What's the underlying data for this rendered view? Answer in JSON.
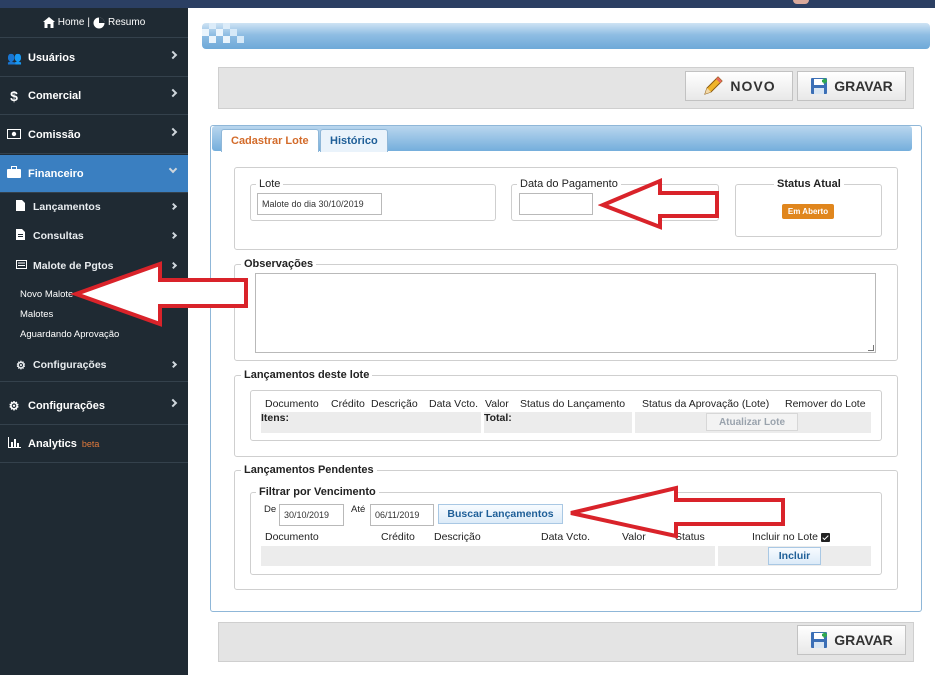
{
  "sidebar": {
    "home_label": "Home",
    "resumo_label": "Resumo",
    "items": [
      {
        "label": "Usuários",
        "icon": "users-icon"
      },
      {
        "label": "Comercial",
        "icon": "dollar-icon"
      },
      {
        "label": "Comissão",
        "icon": "money-icon"
      },
      {
        "label": "Financeiro",
        "icon": "briefcase-icon"
      },
      {
        "label": "Configurações",
        "icon": "gears-icon"
      },
      {
        "label": "Analytics",
        "icon": "bar-chart-icon"
      }
    ],
    "beta_label": "beta",
    "sub_items": [
      {
        "label": "Lançamentos",
        "icon": "file-icon"
      },
      {
        "label": "Consultas",
        "icon": "file-text-icon"
      },
      {
        "label": "Malote de Pgtos",
        "icon": "list-icon"
      },
      {
        "label": "Configurações",
        "icon": "gear-icon"
      }
    ],
    "malote_items": [
      "Novo Malote",
      "Malotes",
      "Aguardando Aprovação"
    ]
  },
  "toolbar": {
    "novo_label": "NOVO",
    "gravar_label": "GRAVAR"
  },
  "tabs": [
    "Cadastrar Lote",
    "Histórico"
  ],
  "form": {
    "lote_legend": "Lote",
    "lote_value": "Malote do dia 30/10/2019",
    "data_pagamento_legend": "Data do Pagamento",
    "data_pagamento_value": "",
    "status_legend": "Status Atual",
    "status_badge": "Em Aberto",
    "observacoes_legend": "Observações"
  },
  "lancamentos_lote": {
    "legend": "Lançamentos deste lote",
    "columns": [
      "Documento",
      "Crédito",
      "Descrição",
      "Data Vcto.",
      "Valor",
      "Status do Lançamento",
      "Status da Aprovação (Lote)",
      "Remover do Lote"
    ],
    "itens_label": "Itens:",
    "total_label": "Total:",
    "update_button": "Atualizar Lote"
  },
  "pendentes": {
    "legend": "Lançamentos Pendentes",
    "filter_legend": "Filtrar por Vencimento",
    "de_label": "De",
    "de_value": "30/10/2019",
    "ate_label": "Até",
    "ate_value": "06/11/2019",
    "search_button": "Buscar Lançamentos",
    "columns": [
      "Documento",
      "Crédito",
      "Descrição",
      "Data Vcto.",
      "Valor",
      "Status",
      "Incluir no Lote"
    ],
    "include_button": "Incluir"
  },
  "colors": {
    "sidebar_bg": "#1f2a33",
    "active_item": "#3a7fc1",
    "badge_orange": "#e0861d",
    "arrow_red": "#d9232a"
  }
}
